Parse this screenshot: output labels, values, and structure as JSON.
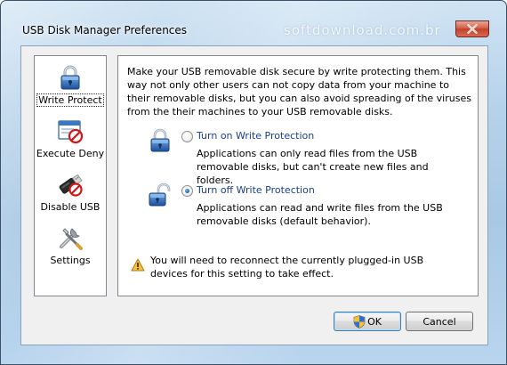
{
  "window": {
    "title": "USB Disk Manager Preferences",
    "watermark": "softdownload.com.br"
  },
  "sidebar": {
    "items": [
      {
        "label": "Write Protect",
        "icon": "padlock-icon",
        "selected": true
      },
      {
        "label": "Execute Deny",
        "icon": "blocked-window-icon",
        "selected": false
      },
      {
        "label": "Disable USB",
        "icon": "usb-drive-blocked-icon",
        "selected": false
      },
      {
        "label": "Settings",
        "icon": "tools-icon",
        "selected": false
      }
    ]
  },
  "panel": {
    "description": "Make your USB removable disk secure by write protecting them. This way not only other users can not copy data from your machine to their removable disks, but you can also avoid spreading of the viruses from the their machines to your USB removable disks.",
    "options": [
      {
        "label": "Turn on Write Protection",
        "description": "Applications can only read files from the USB removable disks, but can't create new files and folders.",
        "checked": false,
        "icon": "locked-padlock-icon"
      },
      {
        "label": "Turn off Write Protection",
        "description": "Applications can read and write files from the USB removable disks (default behavior).",
        "checked": true,
        "icon": "unlocked-padlock-icon"
      }
    ],
    "warning": "You will need to reconnect the currently plugged-in USB devices for this setting to take effect."
  },
  "buttons": {
    "ok": "OK",
    "cancel": "Cancel"
  },
  "colors": {
    "accent": "#1a3f8f",
    "close": "#c2402a",
    "frame": "#a9c8e4"
  }
}
